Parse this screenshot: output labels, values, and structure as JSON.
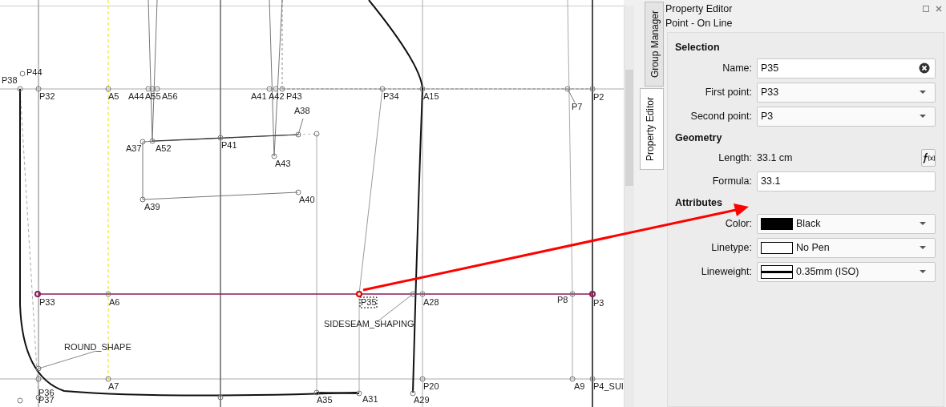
{
  "canvas": {
    "points": [
      {
        "label": "P38",
        "selected": false
      },
      {
        "label": "P44",
        "selected": false
      },
      {
        "label": "P32",
        "selected": false
      },
      {
        "label": "A5",
        "selected": false
      },
      {
        "label": "A44",
        "selected": false
      },
      {
        "label": "A55",
        "selected": false
      },
      {
        "label": "A56",
        "selected": false
      },
      {
        "label": "A41",
        "selected": false
      },
      {
        "label": "A42",
        "selected": false
      },
      {
        "label": "P43",
        "selected": false
      },
      {
        "label": "P34",
        "selected": false
      },
      {
        "label": "A15",
        "selected": false
      },
      {
        "label": "P7",
        "selected": false
      },
      {
        "label": "P2",
        "selected": false
      },
      {
        "label": "A38",
        "selected": false
      },
      {
        "label": "A37",
        "selected": false
      },
      {
        "label": "A52",
        "selected": false
      },
      {
        "label": "P41",
        "selected": false
      },
      {
        "label": "A43",
        "selected": false
      },
      {
        "label": "A39",
        "selected": false
      },
      {
        "label": "A40",
        "selected": false
      },
      {
        "label": "P33",
        "selected": false
      },
      {
        "label": "A6",
        "selected": false
      },
      {
        "label": "P35",
        "selected": true
      },
      {
        "label": "A28",
        "selected": false
      },
      {
        "label": "P8",
        "selected": false
      },
      {
        "label": "P3",
        "selected": false
      },
      {
        "label": "P36",
        "selected": false
      },
      {
        "label": "A7",
        "selected": false
      },
      {
        "label": "P20",
        "selected": false
      },
      {
        "label": "A9",
        "selected": false
      },
      {
        "label": "P4_SUI",
        "selected": false
      },
      {
        "label": "P37",
        "selected": false
      },
      {
        "label": "A35",
        "selected": false
      },
      {
        "label": "A31",
        "selected": false
      },
      {
        "label": "A29",
        "selected": false
      }
    ],
    "shape_labels": [
      {
        "label": "ROUND_SHAPE"
      },
      {
        "label": "SIDESEAM_SHAPING"
      }
    ]
  },
  "side_tabs": [
    {
      "label": "Group Manager",
      "selected": false
    },
    {
      "label": "Property Editor",
      "selected": true
    }
  ],
  "panel": {
    "title": "Property Editor",
    "subtitle": "Point - On Line",
    "sections": [
      {
        "heading": "Selection",
        "fields": [
          {
            "kind": "text",
            "label": "Name:",
            "value": "P35",
            "clearable": true
          },
          {
            "kind": "combo",
            "label": "First point:",
            "value": "P33"
          },
          {
            "kind": "combo",
            "label": "Second point:",
            "value": "P3"
          }
        ]
      },
      {
        "heading": "Geometry",
        "fields": [
          {
            "kind": "readout",
            "label": "Length:",
            "value": "33.1 cm"
          },
          {
            "kind": "text",
            "label": "Formula:",
            "value": "33.1",
            "clearable": false
          }
        ]
      },
      {
        "heading": "Attributes",
        "fields": [
          {
            "kind": "color",
            "label": "Color:",
            "value": "Black",
            "color": "#000000"
          },
          {
            "kind": "linetype",
            "label": "Linetype:",
            "value": "No Pen"
          },
          {
            "kind": "lineweight",
            "label": "Lineweight:",
            "value": "0.35mm (ISO)"
          }
        ]
      }
    ]
  }
}
